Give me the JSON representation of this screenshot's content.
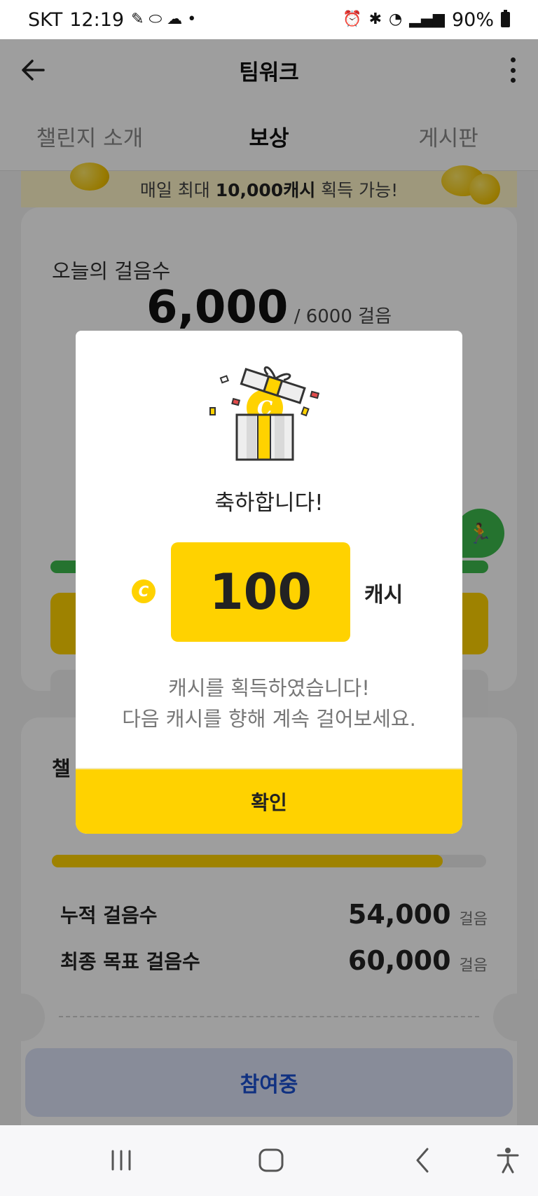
{
  "status_bar": {
    "carrier": "SKT",
    "time": "12:19",
    "battery": "90%"
  },
  "app_bar": {
    "title": "팀워크"
  },
  "tabs": [
    {
      "label": "챌린지 소개"
    },
    {
      "label": "보상"
    },
    {
      "label": "게시판"
    }
  ],
  "banner": {
    "prefix": "매일 최대 ",
    "highlight": "10,000캐시",
    "suffix": " 획득 가능!"
  },
  "today_card": {
    "label": "오늘의 걸음수",
    "steps": "6,000",
    "goal": " / 6000 걸음",
    "progress": 1.0
  },
  "challenge_card": {
    "title_partial": "챌",
    "progress": 0.9,
    "rows": [
      {
        "label": "누적 걸음수",
        "value": "54,000",
        "unit": "걸음"
      },
      {
        "label": "최종 목표 걸음수",
        "value": "60,000",
        "unit": "걸음"
      }
    ]
  },
  "cta": {
    "label": "참여중"
  },
  "dialog": {
    "title": "축하합니다!",
    "amount": "100",
    "unit": "캐시",
    "coin_letter": "C",
    "message_line1": "캐시를 획득하였습니다!",
    "message_line2": "다음 캐시를 향해 계속 걸어보세요.",
    "confirm_label": "확인"
  },
  "colors": {
    "accent_yellow": "#ffd200",
    "green": "#3cba4c",
    "cta_text": "#1b4fd1"
  }
}
